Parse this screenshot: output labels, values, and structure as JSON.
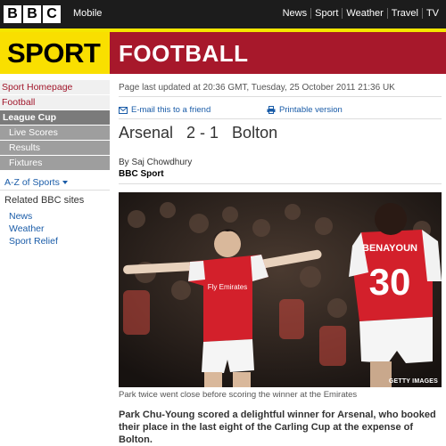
{
  "header": {
    "logo_letters": [
      "B",
      "B",
      "C"
    ],
    "mobile_label": "Mobile",
    "nav": [
      "News",
      "Sport",
      "Weather",
      "Travel",
      "TV"
    ]
  },
  "banner": {
    "section": "SPORT",
    "subsection": "FOOTBALL",
    "colors": {
      "yellow": "#f9df00",
      "red": "#a7182b"
    }
  },
  "sidebar": {
    "items": [
      {
        "label": "Sport Homepage"
      },
      {
        "label": "Football"
      },
      {
        "label": "League Cup"
      },
      {
        "label": "Live Scores"
      },
      {
        "label": "Results"
      },
      {
        "label": "Fixtures"
      }
    ],
    "az_label": "A-Z of Sports",
    "related_heading": "Related BBC sites",
    "related": [
      "News",
      "Weather",
      "Sport Relief"
    ]
  },
  "article": {
    "updated": "Page last updated at 20:36 GMT, Tuesday, 25 October 2011 21:36 UK",
    "email_label": "E-mail this to a friend",
    "print_label": "Printable version",
    "headline": "Arsenal   2 - 1   Bolton",
    "byline": "By Saj Chowdhury",
    "byline_org": "BBC Sport",
    "photo": {
      "shirt_text": "Fly Emirates",
      "shirt_name": "BENAYOUN",
      "shirt_number": "30",
      "credit": "GETTY IMAGES"
    },
    "caption": "Park twice went close before scoring the winner at the Emirates",
    "intro": "Park Chu-Young scored a delightful winner for Arsenal, who booked their place in the last eight of the Carling Cup at the expense of Bolton."
  }
}
